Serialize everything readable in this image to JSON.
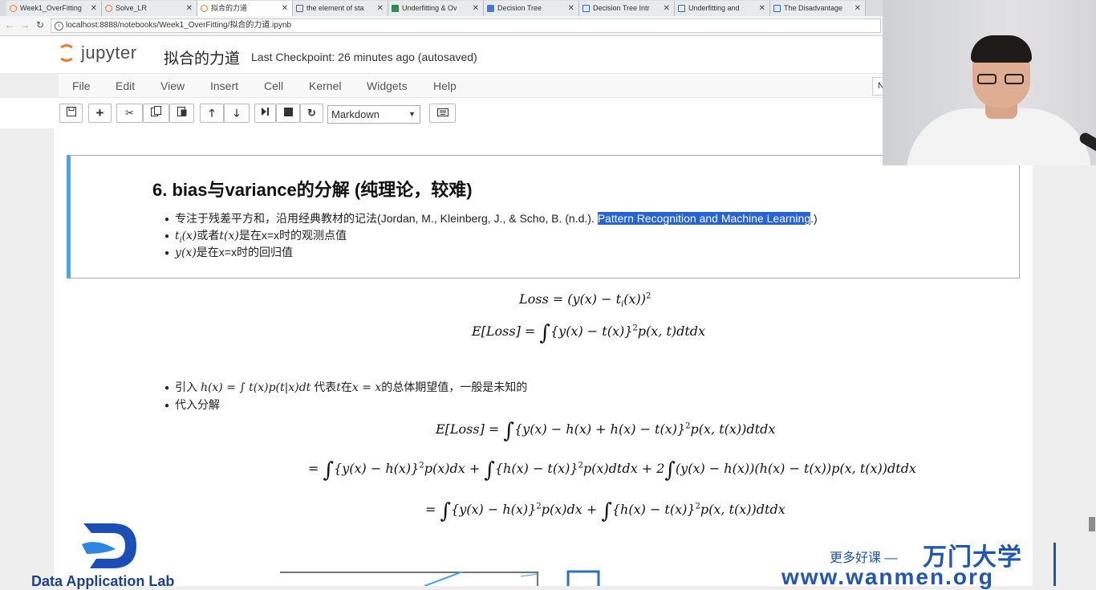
{
  "browser": {
    "tabs": [
      {
        "title": "Week1_OverFitting",
        "icon": "jupyter"
      },
      {
        "title": "Solve_LR",
        "icon": "jupyter"
      },
      {
        "title": "拟合的力道",
        "icon": "jupyter",
        "active": true
      },
      {
        "title": "the element of sta",
        "icon": "globe"
      },
      {
        "title": "Underfitting & Ov",
        "icon": "sheet"
      },
      {
        "title": "Decision Tree",
        "icon": "doc"
      },
      {
        "title": "Decision Tree Intr",
        "icon": "doc"
      },
      {
        "title": "Underfitting and",
        "icon": "doc"
      },
      {
        "title": "The Disadvantage",
        "icon": "doc"
      }
    ],
    "url": "localhost:8888/notebooks/Week1_OverFitting/拟合的力道.ipynb"
  },
  "jupyter": {
    "logo_text": "jupyter",
    "notebook_title": "拟合的力道",
    "checkpoint": "Last Checkpoint: 26 minutes ago (autosaved)",
    "menu": [
      "File",
      "Edit",
      "View",
      "Insert",
      "Cell",
      "Kernel",
      "Widgets",
      "Help"
    ],
    "kernel_indicator": "N",
    "cell_type": "Markdown"
  },
  "cell": {
    "heading": "6. bias与variance的分解 (纯理论，较难)",
    "bullets": {
      "b1_pre": "专注于残差平方和，沿用经典教材的记法(Jordan, M., Kleinberg, J., & Scho, B. (n.d.). ",
      "b1_highlight": "Pattern Recognition and Machine Learning",
      "b1_post": ".)",
      "b2_math1": "t",
      "b2_sub": "i",
      "b2_math1b": "(x)",
      "b2_mid": "或者",
      "b2_math2": "t(x)",
      "b2_post": "是在x=x时的观测点值",
      "b3_math": "y(x)",
      "b3_post": "是在x=x时的回归值"
    }
  },
  "output": {
    "eq1": "Loss = (y(x) − t",
    "eq1_sub": "i",
    "eq1_tail": "(x))",
    "eq1_sup": "2",
    "eq2_a": "E[Loss] = ",
    "eq2_b": "{y(x) − t(x)}",
    "eq2_c": "p(x, t)dtdx",
    "bullet_intro_pre": "引入 ",
    "bullet_intro_math": "h(x) = ∫ t(x)p(t|x)dt",
    "bullet_intro_mid": " 代表",
    "bullet_intro_t": "t",
    "bullet_intro_mid2": "在",
    "bullet_intro_x": "x = x",
    "bullet_intro_post": "的总体期望值，一般是未知的",
    "bullet_sub": "代入分解",
    "eq3_a": "E[Loss] = ",
    "eq3_b": "{y(x) − h(x) + h(x) − t(x)}",
    "eq3_c": "p(x, t(x))dtdx",
    "eq4_a": "= ",
    "eq4_b": "{y(x) − h(x)}",
    "eq4_c": "p(x)dx + ",
    "eq4_d": "{h(x) − t(x)}",
    "eq4_e": "p(x)dtdx + 2",
    "eq4_f": "(y(x) − h(x))(h(x) − t(x))p(x, t(x))dtdx",
    "eq5_a": "= ",
    "eq5_b": "{y(x) − h(x)}",
    "eq5_c": "p(x)dx + ",
    "eq5_d": "{h(x) − t(x)}",
    "eq5_e": "p(x, t(x))dtdx",
    "sq": "2",
    "integral": "∫"
  },
  "watermark": {
    "lab_name": "Data Application Lab",
    "slogan": "更多好课 —",
    "brand": "万门大学",
    "url": "www.wanmen.org"
  },
  "colors": {
    "jupyter_orange": "#f37726",
    "cell_selected_border": "#42a5f5",
    "highlight": "#2563d6",
    "watermark_blue": "#1f55b3"
  }
}
